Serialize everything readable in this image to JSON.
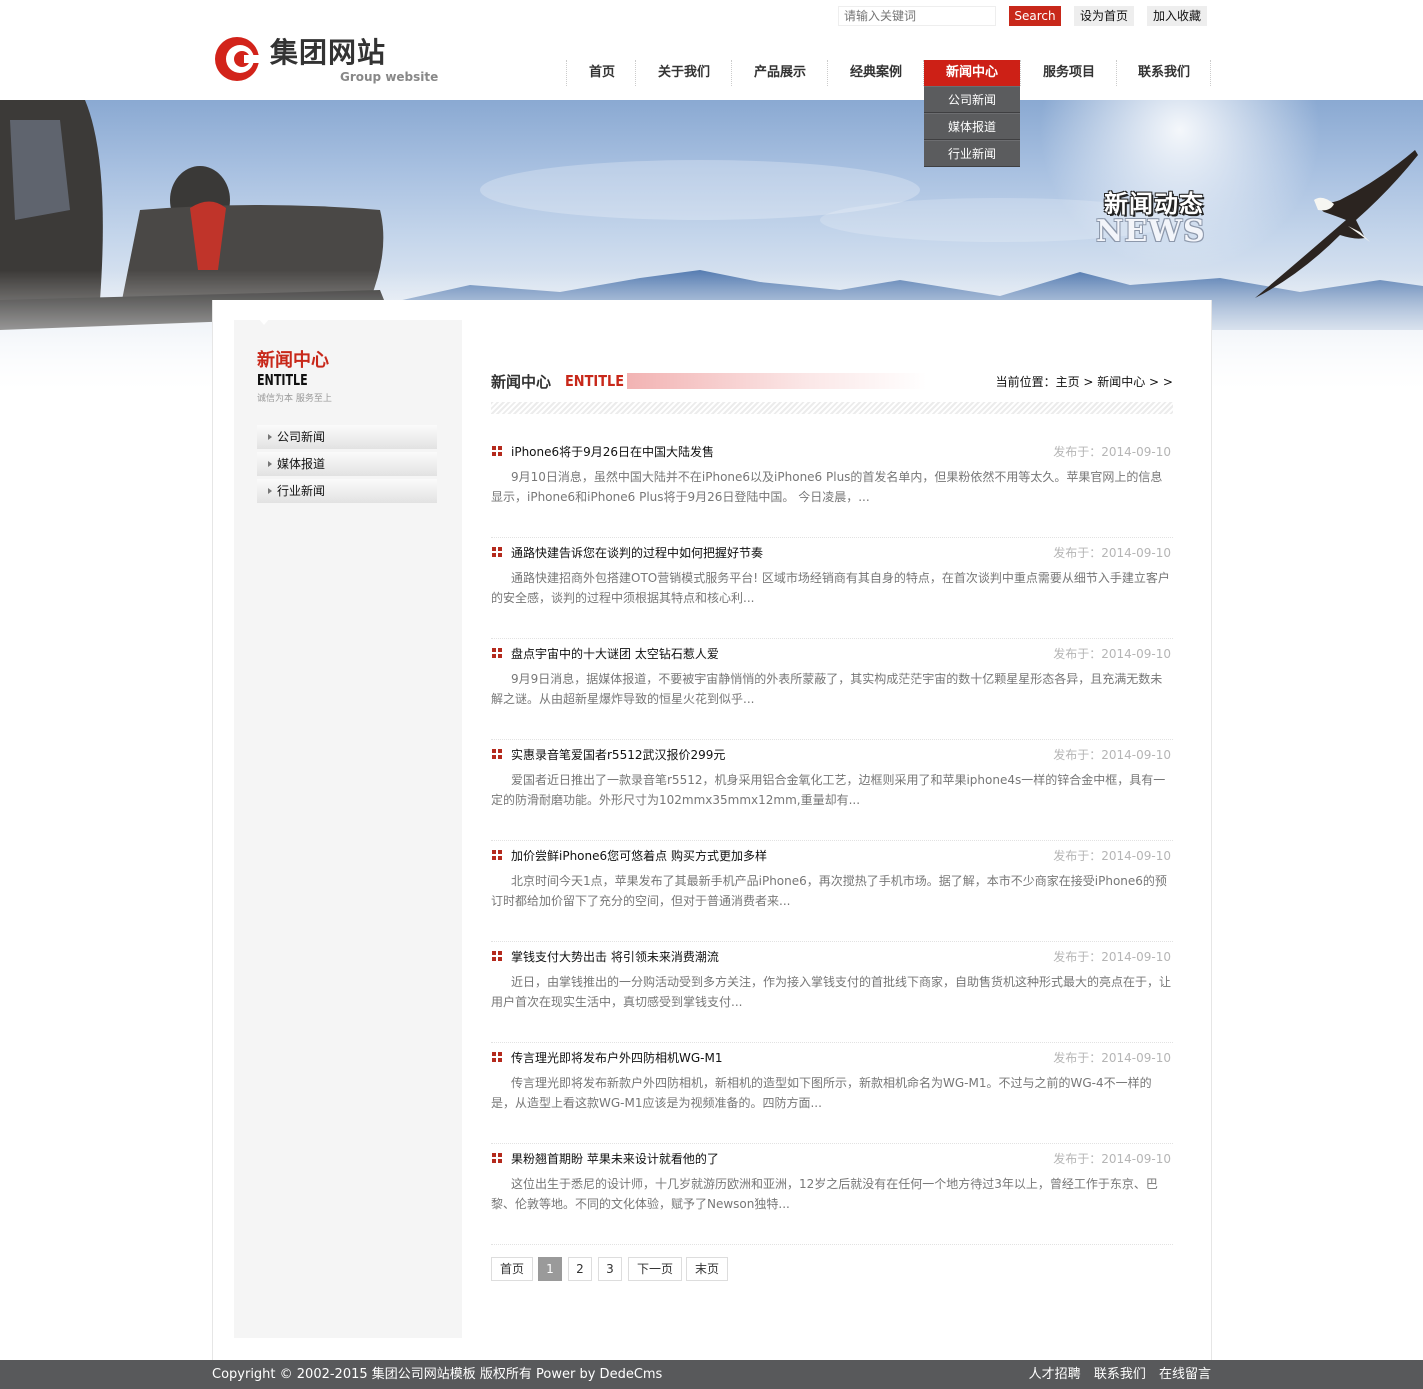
{
  "header": {
    "logo_cn": "集团网站",
    "logo_en": "Group website",
    "search_placeholder": "请输入关键词",
    "search_label": "Search",
    "set_home": "设为首页",
    "add_favorite": "加入收藏"
  },
  "nav": {
    "items": [
      "首页",
      "关于我们",
      "产品展示",
      "经典案例",
      "新闻中心",
      "服务项目",
      "联系我们"
    ],
    "active": "新闻中心",
    "dropdown": [
      "公司新闻",
      "媒体报道",
      "行业新闻"
    ]
  },
  "banner": {
    "title_cn": "新闻动态",
    "title_en": "NEWS"
  },
  "sidebar": {
    "title_cn": "新闻中心",
    "title_en": "ENTITLE",
    "slogan": "诚信为本 服务至上",
    "menu": [
      "公司新闻",
      "媒体报道",
      "行业新闻"
    ]
  },
  "content": {
    "title_cn": "新闻中心",
    "title_en": "ENTITLE",
    "breadcrumb": "当前位置：主页 > 新闻中心 > >",
    "articles": [
      {
        "title": "iPhone6将于9月26日在中国大陆发售",
        "date": "发布于：2014-09-10",
        "desc": "9月10日消息，虽然中国大陆并不在iPhone6以及iPhone6 Plus的首发名单内，但果粉依然不用等太久。苹果官网上的信息显示，iPhone6和iPhone6 Plus将于9月26日登陆中国。 今日凌晨，..."
      },
      {
        "title": "通路快建告诉您在谈判的过程中如何把握好节奏",
        "date": "发布于：2014-09-10",
        "desc": "通路快建招商外包搭建OTO营销模式服务平台! 区域市场经销商有其自身的特点，在首次谈判中重点需要从细节入手建立客户的安全感，谈判的过程中须根据其特点和核心利..."
      },
      {
        "title": "盘点宇宙中的十大谜团 太空钻石惹人爱",
        "date": "发布于：2014-09-10",
        "desc": "9月9日消息，据媒体报道，不要被宇宙静悄悄的外表所蒙蔽了，其实构成茫茫宇宙的数十亿颗星星形态各异，且充满无数未解之谜。从由超新星爆炸导致的恒星火花到似乎..."
      },
      {
        "title": "实惠录音笔爱国者r5512武汉报价299元",
        "date": "发布于：2014-09-10",
        "desc": "爱国者近日推出了一款录音笔r5512，机身采用铝合金氧化工艺，边框则采用了和苹果iphone4s一样的锌合金中框，具有一定的防滑耐磨功能。外形尺寸为102mmx35mmx12mm,重量却有..."
      },
      {
        "title": "加价尝鲜iPhone6您可悠着点 购买方式更加多样",
        "date": "发布于：2014-09-10",
        "desc": "北京时间今天1点，苹果发布了其最新手机产品iPhone6，再次搅热了手机市场。据了解，本市不少商家在接受iPhone6的预订时都给加价留下了充分的空间，但对于普通消费者来..."
      },
      {
        "title": "掌钱支付大势出击 将引领未来消费潮流",
        "date": "发布于：2014-09-10",
        "desc": "近日，由掌钱推出的一分购活动受到多方关注，作为接入掌钱支付的首批线下商家，自助售货机这种形式最大的亮点在于，让用户首次在现实生活中，真切感受到掌钱支付..."
      },
      {
        "title": "传言理光即将发布户外四防相机WG-M1",
        "date": "发布于：2014-09-10",
        "desc": "传言理光即将发布新款户外四防相机，新相机的造型如下图所示，新款相机命名为WG-M1。不过与之前的WG-4不一样的是，从造型上看这款WG-M1应该是为视频准备的。四防方面..."
      },
      {
        "title": "果粉翘首期盼 苹果未来设计就看他的了",
        "date": "发布于：2014-09-10",
        "desc": "这位出生于悉尼的设计师，十几岁就游历欧洲和亚洲，12岁之后就没有在任何一个地方待过3年以上，曾经工作于东京、巴黎、伦敦等地。不同的文化体验，赋予了Newson独特..."
      }
    ],
    "pager": {
      "first": "首页",
      "pages": [
        "1",
        "2",
        "3"
      ],
      "current": "1",
      "next": "下一页",
      "last": "末页"
    }
  },
  "footer": {
    "copyright": "Copyright © 2002-2015 集团公司网站模板 版权所有 Power by DedeCms",
    "links": [
      "人才招聘",
      "联系我们",
      "在线留言"
    ]
  },
  "colors": {
    "accent": "#c8281a",
    "footer_bg": "#58595b",
    "dropdown_bg": "#5b5c5e"
  }
}
